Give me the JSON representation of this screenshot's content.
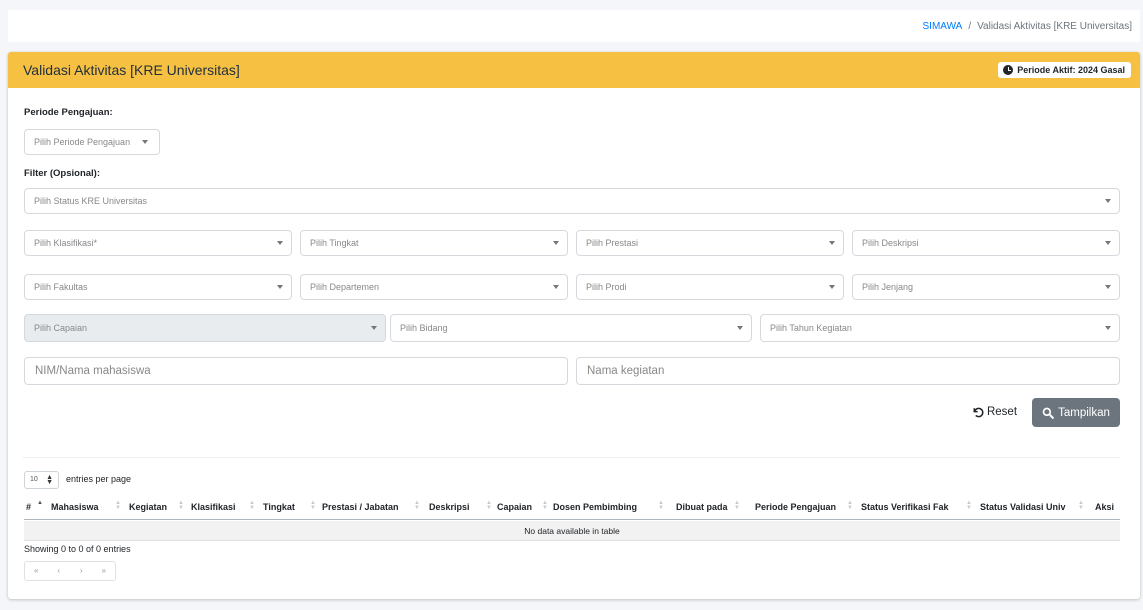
{
  "breadcrumb": {
    "home": "SIMAWA",
    "separator": "/",
    "current": "Validasi Aktivitas [KRE Universitas]"
  },
  "card": {
    "title": "Validasi Aktivitas [KRE Universitas]",
    "period_badge": "Periode Aktif: 2024 Gasal",
    "header_color": "#f6c143"
  },
  "form": {
    "period_label": "Periode Pengajuan:",
    "period_select": "Pilih Periode Pengajuan",
    "filter_label": "Filter (Opsional):",
    "status_select": "Pilih Status KRE Universitas",
    "klasifikasi": "Pilih Klasifikasi*",
    "tingkat": "Pilih Tingkat",
    "prestasi": "Pilih Prestasi",
    "deskripsi": "Pilih Deskripsi",
    "fakultas": "Pilih Fakultas",
    "departemen": "Pilih Departemen",
    "prodi": "Pilih Prodi",
    "jenjang": "Pilih Jenjang",
    "capaian": "Pilih Capaian",
    "bidang": "Pilih Bidang",
    "tahun_kegiatan": "Pilih Tahun Kegiatan",
    "nim_placeholder": "NIM/Nama mahasiswa",
    "kegiatan_placeholder": "Nama kegiatan",
    "reset_label": "Reset",
    "show_label": "Tampilkan",
    "show_button_color": "#6c757d"
  },
  "table": {
    "page_size": "10",
    "entries_label": "entries per page",
    "columns": [
      "#",
      "Mahasiswa",
      "Kegiatan",
      "Klasifikasi",
      "Tingkat",
      "Prestasi / Jabatan",
      "Deskripsi",
      "Capaian",
      "Dosen Pembimbing",
      "Dibuat pada",
      "Periode Pengajuan",
      "Status Verifikasi Fak",
      "Status Validasi Univ",
      "Aksi"
    ],
    "empty_message": "No data available in table",
    "info": "Showing 0 to 0 of 0 entries",
    "pager": [
      "«",
      "‹",
      "›",
      "»"
    ]
  }
}
